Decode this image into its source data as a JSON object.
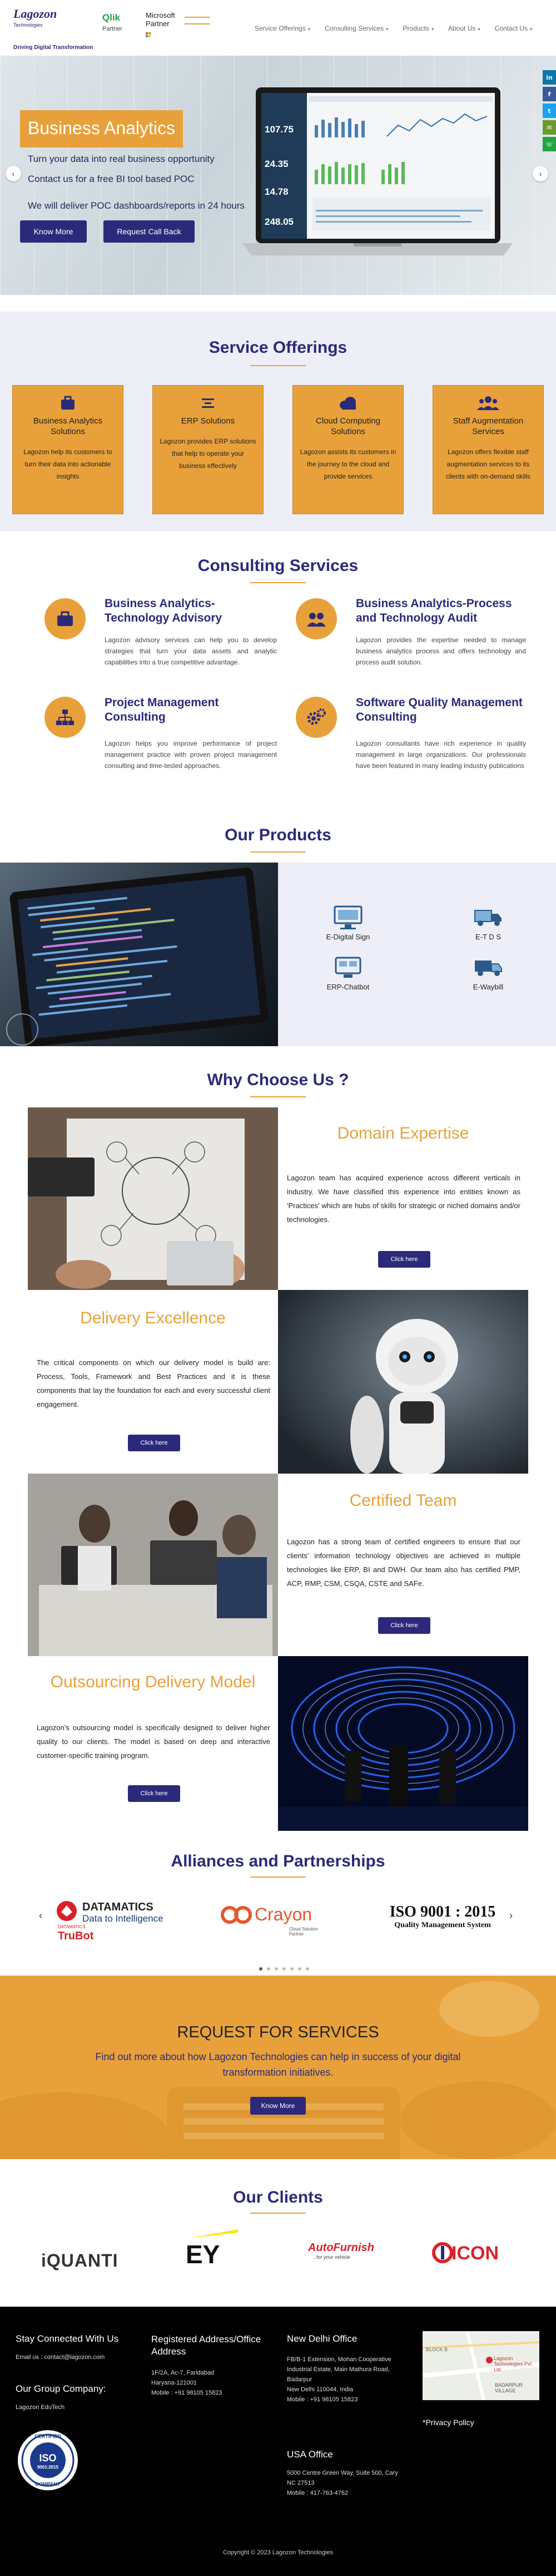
{
  "header": {
    "tagline": "Driving Digital Transformation",
    "logo_main": "Lagozon",
    "logo_sub": "Technologies",
    "qlik_name": "Qlik",
    "qlik_partner": "Partner",
    "ms_name": "Microsoft",
    "ms_partner": "Partner",
    "nav": [
      {
        "label": "Service Offerings"
      },
      {
        "label": "Consulting Services"
      },
      {
        "label": "Products"
      },
      {
        "label": "About Us"
      },
      {
        "label": "Contact Us"
      }
    ]
  },
  "social": [
    "in",
    "f",
    "t",
    "✉",
    "☏"
  ],
  "hero": {
    "title": "Business Analytics",
    "lines": [
      "Turn your data into real business opportunity",
      "Contact us for a free BI tool based POC",
      "We will deliver POC dashboards/reports in 24 hours"
    ],
    "btn_know": "Know More",
    "btn_callback": "Request Call Back",
    "dash_values": [
      "107.75",
      "24.35",
      "14.78",
      "248.05"
    ]
  },
  "services": {
    "title": "Service Offerings",
    "cards": [
      {
        "title": "Business Analytics Solutions",
        "text": "Lagozon help its customers to turn their data into actionable insights"
      },
      {
        "title": "ERP Solutions",
        "text": "Lagozon provides ERP solutions that help to operate your business effectively"
      },
      {
        "title": "Cloud Computing Solutions",
        "text": "Lagozon assists its customers in the journey to the cloud and provide services"
      },
      {
        "title": "Staff Augmentation Services",
        "text": "Lagozon offers flexible staff augmentation services to its clients with on-demand skills"
      }
    ]
  },
  "consulting": {
    "title": "Consulting Services",
    "items": [
      {
        "title": "Business Analytics-Technology Advisory",
        "text": "Lagozon advisory services can help you to develop strategies that turn your data assets and analytic capabilities into a true competitive advantage."
      },
      {
        "title": "Business Analytics-Process and Technology Audit",
        "text": "Lagozon provides the expertise needed to manage business analytics process and offers technology and process audit solution."
      },
      {
        "title": "Project Management Consulting",
        "text": "Lagozon helps you improve performance of project management practice with proven project management consulting and time-tested approaches."
      },
      {
        "title": "Software Quality Management Consulting",
        "text": "Lagozon consultants have rich experience in quality management in large organizations. Our professionals have been featured in many leading industry publications"
      }
    ]
  },
  "products": {
    "title": "Our Products",
    "items": [
      {
        "label": "E-Digital Sign"
      },
      {
        "label": "E-T D S"
      },
      {
        "label": "ERP-Chatbot"
      },
      {
        "label": "E-Waybill"
      }
    ]
  },
  "why": {
    "title": "Why Choose Us ?",
    "button": "Click here",
    "blocks": [
      {
        "heading": "Domain Expertise",
        "text": "Lagozon team has acquired experience across different verticals in industry. We have classified this experience into entities known as 'Practices' which are hubs of skills for strategic or niched domains and/or technologies."
      },
      {
        "heading": "Delivery Excellence",
        "text": "The critical components on which our delivery model is build are: Process, Tools, Framework and Best Practices and it is these components that lay the foundation for each and every successful client engagement."
      },
      {
        "heading": "Certified Team",
        "text": "Lagozon has a strong team of certified engineers to ensure that our clients' information technology objectives are achieved in multiple technologies like ERP, BI and DWH. Our team also has certified PMP, ACP, RMP, CSM, CSQA, CSTE and SAFe."
      },
      {
        "heading": "Outsourcing Delivery Model",
        "text": "Lagozon's outsourcing model is specifically designed to deliver higher quality to our clients. The model is based on deep and interactive customer-specific training program."
      }
    ]
  },
  "alliances": {
    "title": "Alliances and Partnerships",
    "datamatics": "DATAMATICS",
    "datamatics_sub": "Data to Intelligence",
    "trubot_pre": "DATAMATICS",
    "trubot": "TruBot",
    "crayon": "Crayon",
    "crayon_sub": "Cloud Solution Partner",
    "iso_title": "ISO 9001 : 2015",
    "iso_sub": "Quality Management System"
  },
  "request": {
    "title": "REQUEST FOR SERVICES",
    "text": "Find out more about how Lagozon Technologies can help in success of your digital transformation initiatives.",
    "button": "Know More"
  },
  "clients": {
    "title": "Our Clients",
    "names": [
      "iQUANTI",
      "EY",
      "AutoFurnish",
      "ICON"
    ],
    "autofurnish_tag": "..for your vehicle"
  },
  "footer": {
    "stay_title": "Stay Connected With Us",
    "email": "Email us : contact@lagozon.com",
    "group_title": "Our Group Company:",
    "group_name": "Lagozon EduTech",
    "reg_title": "Registered Address/Office Address",
    "reg_lines": [
      "1F/2A, Ac-7, Faridabad",
      "Haryana-121001",
      "Mobile : +91 98105 15823"
    ],
    "delhi_title": "New Delhi Office",
    "delhi_lines": [
      "FB/B-1 Extension, Mohan Cooperative",
      "Industrial Estate, Main Mathura Road,",
      "Badarpur",
      "New Delhi 110044, India",
      "Mobile : +91 98105 15823"
    ],
    "usa_title": "USA Office",
    "usa_lines": [
      "5000 Centre Green Way, Suite 500, Cary",
      "NC 27513",
      "Mobile : 417-763-4762"
    ],
    "privacy": "*Privacy Policy",
    "map_label": "Lagozon Technologies Pvt. Ltd.",
    "map_area": "BADARPUR VILLAGE",
    "map_block": "BLOCK B",
    "iso_badge": "ISO",
    "iso_badge_sub": "9001:2015",
    "iso_ring_top": "CERTIFIED",
    "iso_ring_bottom": "COMPANY",
    "copyright": "Copyright © 2023 Lagozon Technologies"
  },
  "colors": {
    "brand_blue": "#2b2a7a",
    "accent_orange": "#e8a13a"
  }
}
